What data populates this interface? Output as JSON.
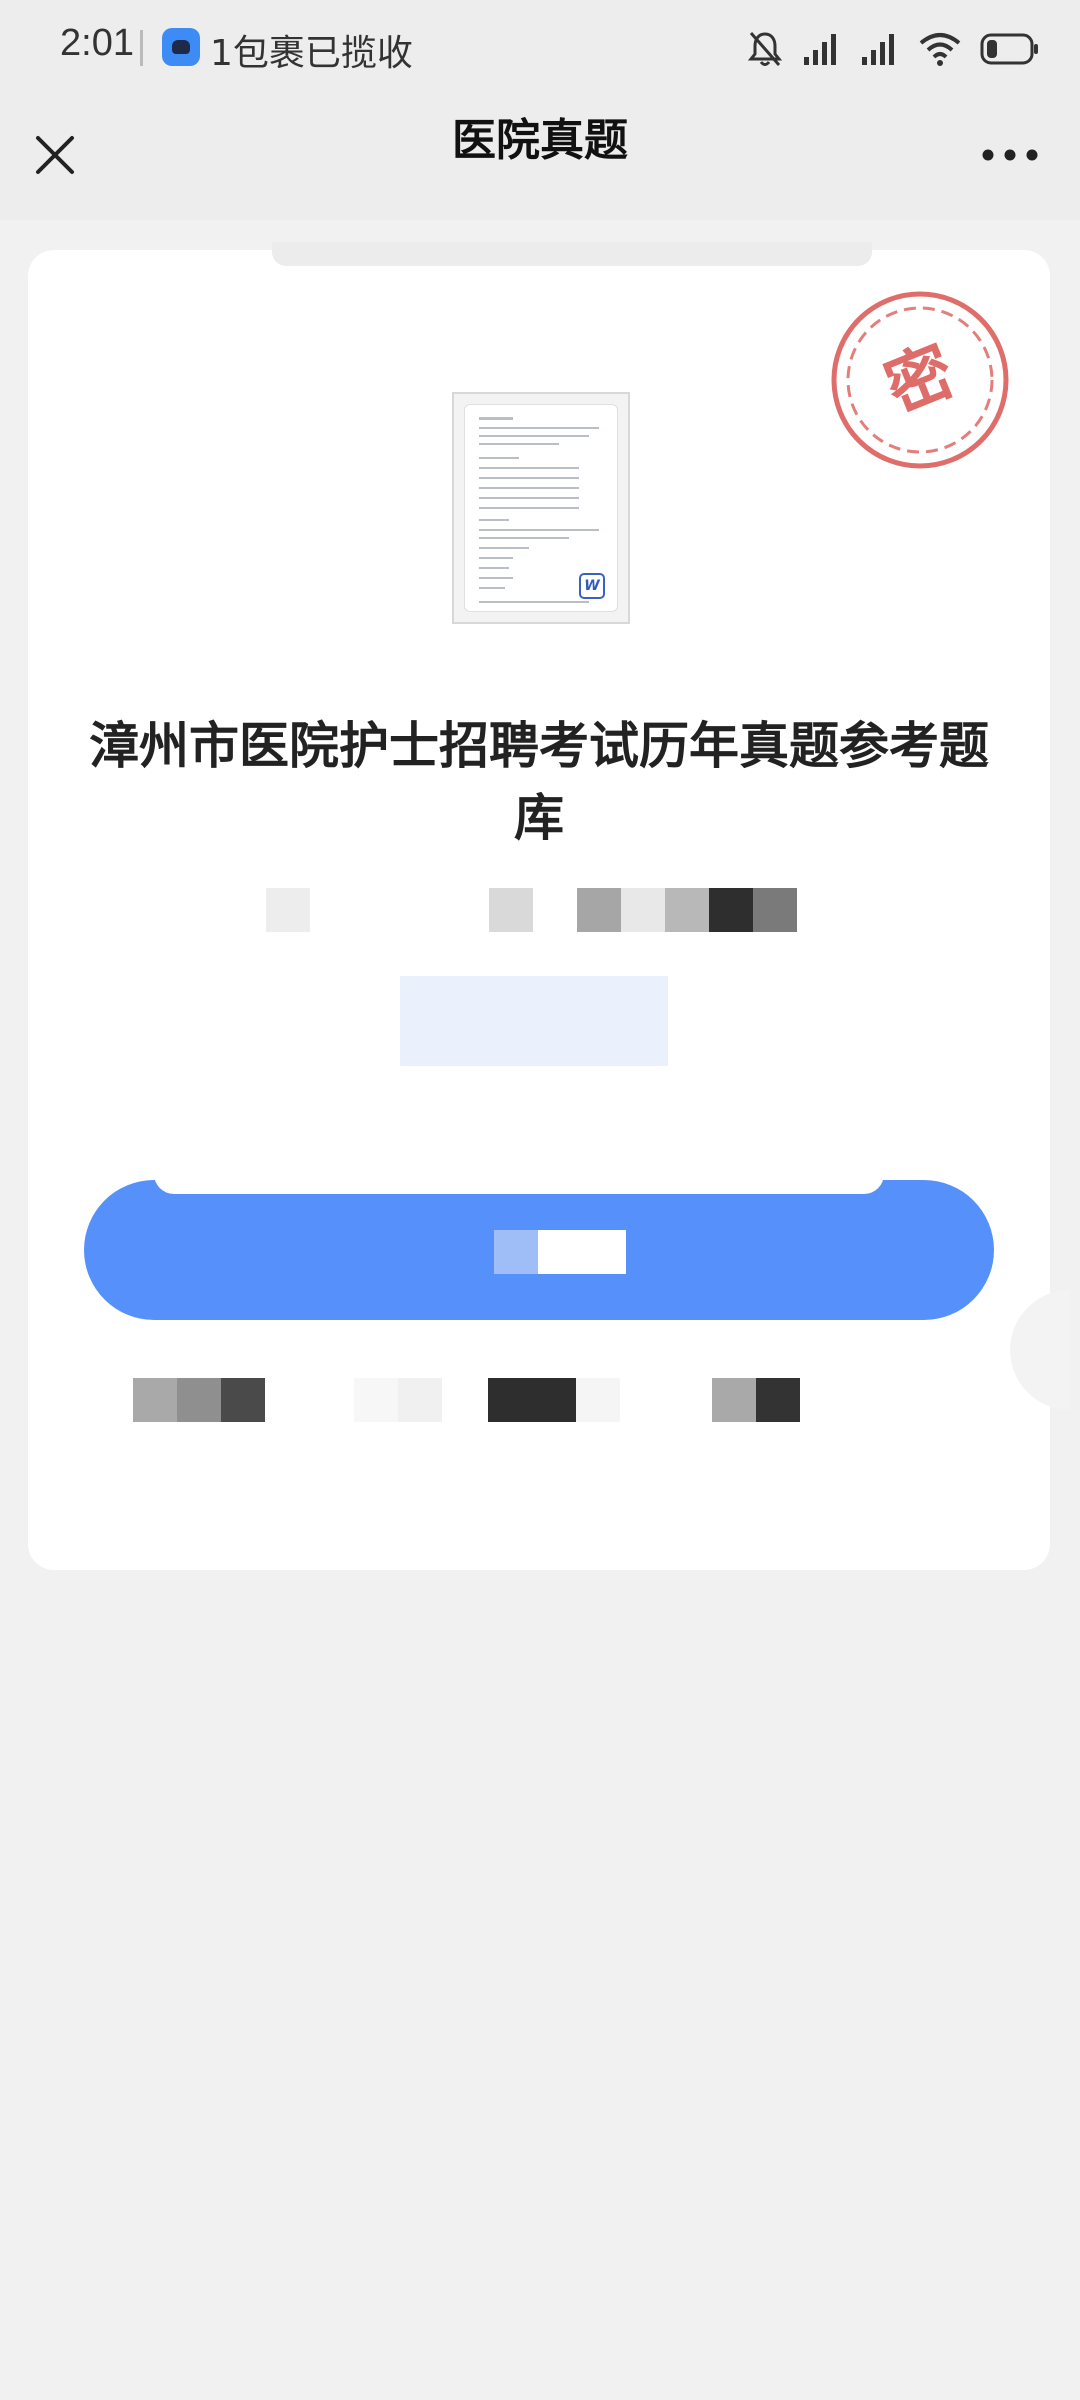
{
  "status_bar": {
    "time": "2:01",
    "notification": "1包裹已揽收",
    "icons": [
      "notification-app-icon",
      "bell-muted-icon",
      "signal-icon",
      "signal-icon",
      "wifi-icon",
      "battery-icon"
    ]
  },
  "nav": {
    "title": "医院真题",
    "close_icon": "close-icon",
    "more_icon": "more-icon"
  },
  "card": {
    "stamp_text": "密",
    "doc_icon": "word-document-icon",
    "title": "漳州市医院护士招聘考试历年真题参考题库"
  },
  "colors": {
    "accent": "#5691fb",
    "stamp": "#d9534f",
    "background": "#f1f1f1"
  }
}
